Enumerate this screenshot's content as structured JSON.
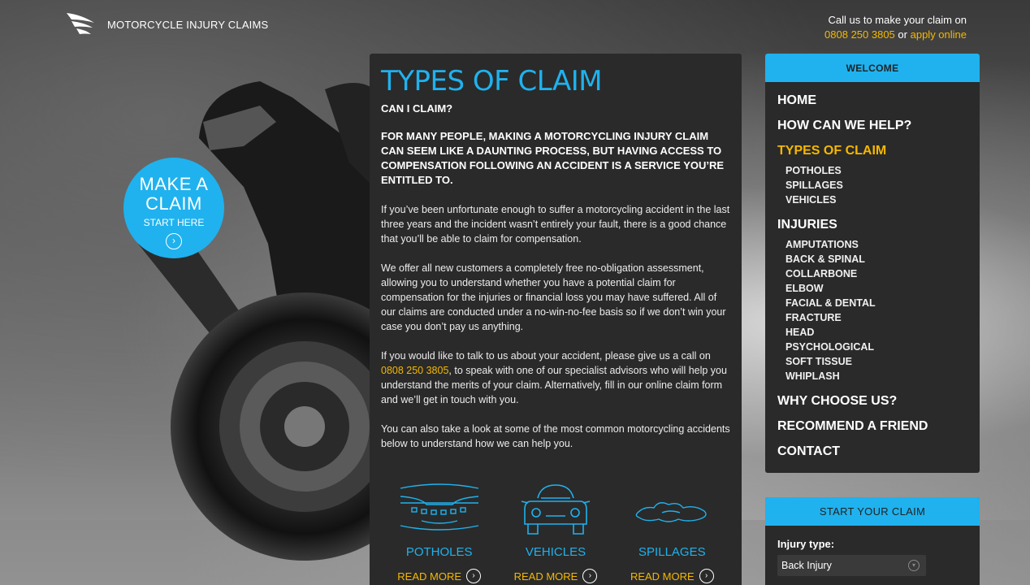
{
  "header": {
    "logo_text": "MOTORCYCLE INJURY CLAIMS",
    "call_line1": "Call us to make your claim on",
    "phone": "0808 250 3805",
    "or_text": "or",
    "apply_online": "apply online"
  },
  "claim_circle": {
    "line1": "MAKE A",
    "line2": "CLAIM",
    "subtitle": "START HERE",
    "arrow": "›"
  },
  "main": {
    "title": "TYPES OF CLAIM",
    "subtitle": "CAN I CLAIM?",
    "lead": "FOR MANY PEOPLE, MAKING A MOTORCYCLING INJURY CLAIM CAN SEEM LIKE A DAUNTING PROCESS, BUT HAVING ACCESS TO COMPENSATION FOLLOWING AN ACCIDENT IS A SERVICE YOU’RE ENTITLED TO.",
    "para1": "If you’ve been unfortunate enough to suffer a motorcycling accident in the last three years and the incident wasn’t entirely your fault, there is a good chance that you’ll be able to claim for compensation.",
    "para2": "We offer all new customers a completely free no-obligation assessment, allowing you to understand whether you have a potential claim for compensation for the injuries or financial loss you may have suffered. All of our claims are conducted under a no-win-no-fee basis so if we don’t win your case you don’t pay us anything.",
    "para3_before": "If you would like to talk to us about your accident, please give us a call on ",
    "para3_phone": "0808 250 3805",
    "para3_after": ", to speak with one of our specialist advisors who will help you understand the merits of your claim. Alternatively, fill in our online claim form and we’ll get in touch with you.",
    "para4": "You can also take a look at some of the most common motorcycling accidents below to understand how we can help you.",
    "types": [
      {
        "label": "POTHOLES",
        "icon": "pothole-icon",
        "read_more": "READ MORE"
      },
      {
        "label": "VEHICLES",
        "icon": "car-icon",
        "read_more": "READ MORE"
      },
      {
        "label": "SPILLAGES",
        "icon": "spillage-icon",
        "read_more": "READ MORE"
      }
    ]
  },
  "sidebar": {
    "header": "WELCOME",
    "items": [
      {
        "label": "HOME"
      },
      {
        "label": "HOW CAN WE HELP?"
      },
      {
        "label": "TYPES OF CLAIM",
        "active": true
      },
      {
        "label": "POTHOLES"
      },
      {
        "label": "SPILLAGES"
      },
      {
        "label": "VEHICLES"
      },
      {
        "label": "INJURIES"
      },
      {
        "label": "AMPUTATIONS"
      },
      {
        "label": "BACK & SPINAL"
      },
      {
        "label": "COLLARBONE"
      },
      {
        "label": "ELBOW"
      },
      {
        "label": "FACIAL & DENTAL"
      },
      {
        "label": "FRACTURE"
      },
      {
        "label": "HEAD"
      },
      {
        "label": "PSYCHOLOGICAL"
      },
      {
        "label": "SOFT TISSUE"
      },
      {
        "label": "WHIPLASH"
      },
      {
        "label": "WHY CHOOSE US?"
      },
      {
        "label": "RECOMMEND A FRIEND"
      },
      {
        "label": "CONTACT"
      }
    ]
  },
  "start_claim": {
    "header": "START YOUR CLAIM",
    "injury_label": "Injury type:",
    "injury_value": "Back Injury"
  },
  "colors": {
    "accent": "#1fb2ee",
    "highlight": "#f5b800",
    "panel": "#2a2a2a"
  }
}
